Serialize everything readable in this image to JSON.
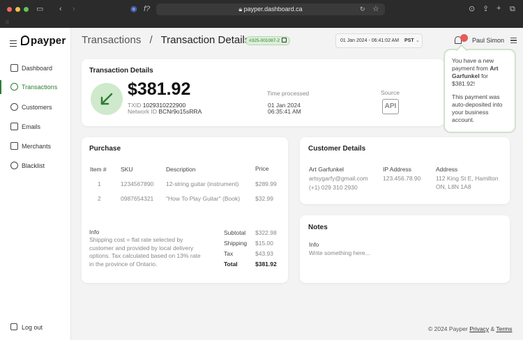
{
  "browser": {
    "url": "payper.dashboard.ca",
    "lock_icon": "lock-icon",
    "colors": {
      "close": "#ed6a5e",
      "minimize": "#f5bf4f",
      "maximize": "#61c554"
    }
  },
  "sidebar": {
    "logo": "payper",
    "items": [
      {
        "label": "Dashboard",
        "icon": "grid-icon",
        "active": false
      },
      {
        "label": "Transactions",
        "icon": "exchange-icon",
        "active": true
      },
      {
        "label": "Customers",
        "icon": "users-icon",
        "active": false
      },
      {
        "label": "Emails",
        "icon": "envelope-icon",
        "active": false
      },
      {
        "label": "Merchants",
        "icon": "store-icon",
        "active": false
      },
      {
        "label": "Blacklist",
        "icon": "ban-icon",
        "active": false
      }
    ],
    "logout_label": "Log out"
  },
  "header": {
    "breadcrumb_parent": "Transactions",
    "breadcrumb_sep": "/",
    "breadcrumb_current": "Transaction Details",
    "txid_pill": "#325-001087-2",
    "datetime": "01 Jan 2024 - 06:41:02 AM",
    "timezone": "PST",
    "user_name": "Paul Simon"
  },
  "transaction": {
    "title": "Transaction Details",
    "amount": "$381.92",
    "txid_label": "TXID",
    "txid": "1029310222900",
    "network_label": "Network ID",
    "network_id": "BCNr9o15sRRA",
    "time_label": "Time processed",
    "time_date": "01 Jan 2024",
    "time_time": "06:35:41 AM",
    "source_label": "Source",
    "source_value": "API"
  },
  "notification": {
    "line1_pre": "You have a new payment from",
    "line1_name": "Art Garfunkel",
    "line1_mid": "for",
    "line1_amount": "$381.92!",
    "line2": "This payment was auto-deposited into your business account."
  },
  "purchase": {
    "title": "Purchase",
    "headers": {
      "item": "Item #",
      "sku": "SKU",
      "desc": "Description",
      "price": "Price"
    },
    "rows": [
      {
        "item": "1",
        "sku": "1234567890",
        "desc": "12-string guitar (instrument)",
        "price": "$289.99"
      },
      {
        "item": "2",
        "sku": "0987654321",
        "desc": "\"How To Play Guitar\" (Book)",
        "price": "$32.99"
      }
    ],
    "info_label": "Info",
    "info_text": "Shipping cost = flat rate selected by customer and provided by local delivery options. Tax calculated based on 13% rate in the province of Ontario.",
    "subtotal_label": "Subtotal",
    "subtotal": "$322.98",
    "shipping_label": "Shipping",
    "shipping": "$15.00",
    "tax_label": "Tax",
    "tax": "$43.93",
    "total_label": "Total",
    "total": "$381.92"
  },
  "customer": {
    "title": "Customer Details",
    "name": "Art Garfunkel",
    "email": "artsygarfy@gmail.com",
    "phone": "(+1) 029 310 2930",
    "ip_label": "IP Address",
    "ip": "123.456.78.90",
    "address_label": "Address",
    "address_line1": "112 King St E, Hamilton",
    "address_line2": "ON, L8N 1A8"
  },
  "notes": {
    "title": "Notes",
    "info_label": "Info",
    "placeholder": "Write something here..."
  },
  "footer": {
    "copyright": "© 2024 Payper",
    "privacy": "Privacy",
    "and": "&",
    "terms": "Terms"
  }
}
